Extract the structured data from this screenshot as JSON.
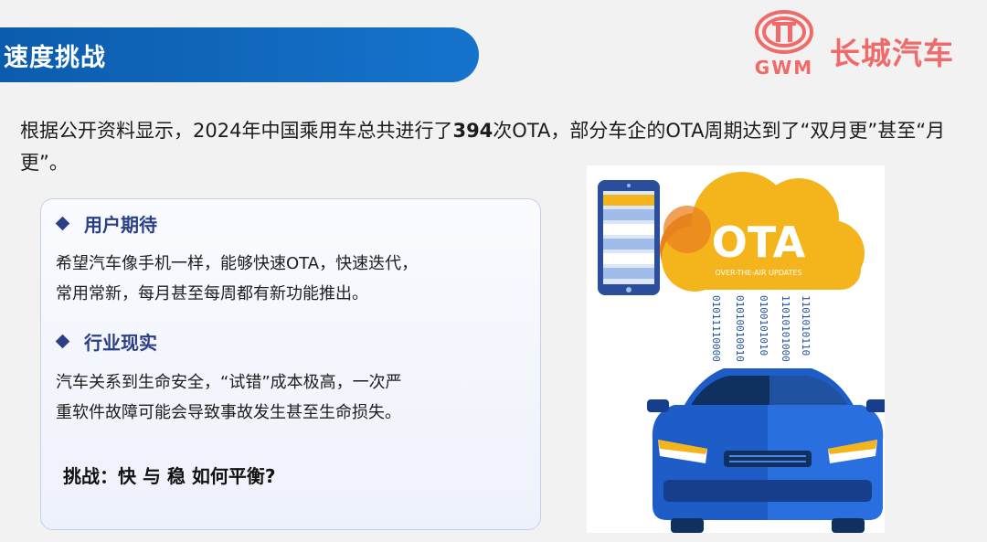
{
  "header": {
    "title": "速度挑战"
  },
  "logo": {
    "brand_cn": "长城汽车",
    "brand_abbr": "GWM",
    "color": "#f06a6a"
  },
  "intro": {
    "before": "根据公开资料显示，2024年中国乘用车总共进行了",
    "highlight": "394",
    "after": "次OTA，部分车企的OTA周期达到了“双月更”甚至“月更”。"
  },
  "card": {
    "sections": [
      {
        "heading": "用户期待",
        "line1": "希望汽车像手机一样，能够快速OTA，快速迭代，",
        "line2": "常用常新，每月甚至每周都有新功能推出。"
      },
      {
        "heading": "行业现实",
        "line1": "汽车关系到生命安全，“试错”成本极高，一次严",
        "line2": "重软件故障可能会导致事故发生甚至生命损失。"
      }
    ],
    "challenge": "挑战：快 与 稳 如何平衡?"
  },
  "illustration": {
    "cloud_title": "OTA",
    "cloud_subtitle": "OVER-THE-AIR UPDATES",
    "binary_streams": [
      "01011110000",
      "01010010010",
      "0100101010",
      "11010101000",
      "1101010110"
    ],
    "colors": {
      "cloud": "#f3b41c",
      "cloud_accent": "#e8821f",
      "car_body": "#1e5cc8",
      "car_dark": "#163e8c",
      "binary": "#1f4f9a"
    }
  }
}
